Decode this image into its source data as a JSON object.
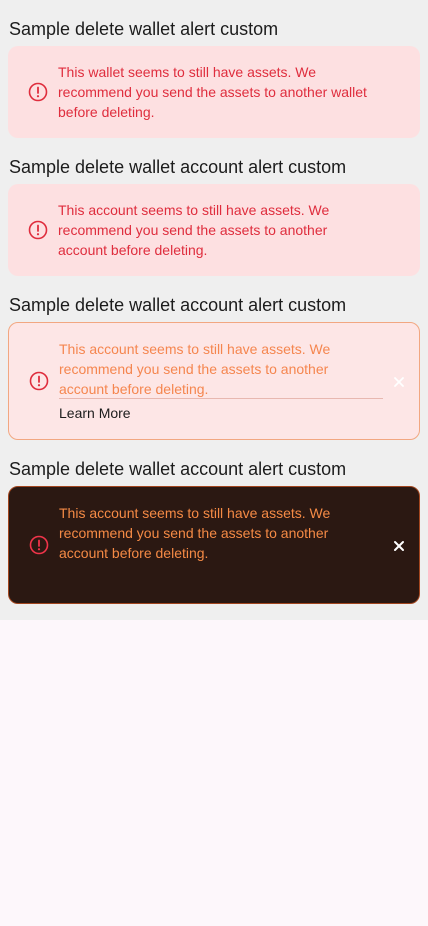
{
  "sections": [
    {
      "title": "Sample delete wallet alert custom",
      "message_lines": [
        "This wallet seems to still have assets. We",
        "recommend you send the assets to another wallet",
        "before deleting."
      ]
    },
    {
      "title": "Sample delete wallet account alert custom",
      "message_lines": [
        "This account seems to still have assets. We",
        "recommend you send the assets to another",
        "account before deleting."
      ]
    },
    {
      "title": "Sample delete wallet account alert custom",
      "message_lines": [
        "This account seems to still have assets. We",
        "recommend you send the assets to another",
        "account before deleting."
      ],
      "link_label": "Learn More"
    },
    {
      "title": "Sample delete wallet account alert custom",
      "message_lines": [
        "This account seems to still have assets. We",
        "recommend you send the assets to another",
        "account before deleting."
      ]
    }
  ],
  "icons": {
    "alert": "alert-circle-icon",
    "close": "close-icon"
  },
  "colors": {
    "error_text": "#df2d3d",
    "error_bg": "#fde0e1",
    "warning_text": "#f5864f",
    "warning_border": "#f2a781",
    "dark_bg": "#2b1812",
    "dark_border": "#a2461f"
  }
}
